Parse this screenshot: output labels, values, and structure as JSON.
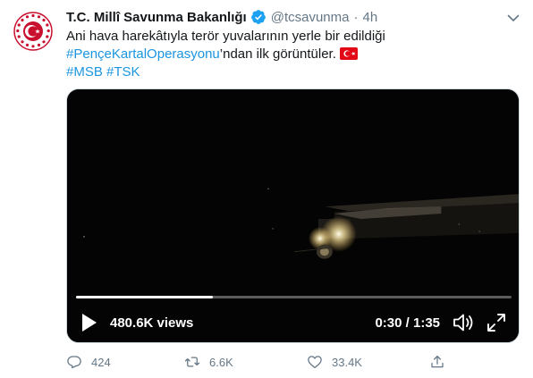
{
  "tweet": {
    "display_name": "T.C. Millî Savunma Bakanlığı",
    "handle": "@tcsavunma",
    "separator": "·",
    "time": "4h",
    "text_line1": "Ani hava harekâtıyla terör yuvalarının yerle bir edildiği",
    "hashtag_operation": "#PençeKartalOperasyonu",
    "text_line2_suffix": "’ndan ilk görüntüler.",
    "hashtag_msb": "#MSB",
    "hashtag_tsk": "#TSK"
  },
  "video": {
    "views": "480.6K views",
    "timecode": "0:30 / 1:35",
    "progress_fraction": 0.315
  },
  "actions": {
    "replies": "424",
    "retweets": "6.6K",
    "likes": "33.4K"
  },
  "colors": {
    "link": "#1b95e0",
    "verified": "#1da1f2",
    "avatar_red": "#c8102e",
    "flag_red": "#e30a17",
    "muted": "#657786"
  },
  "icons": {
    "avatar": "msb-emblem-logo",
    "verified": "verified-badge-icon",
    "caret": "chevron-down-icon",
    "flag": "turkey-flag-emoji",
    "play": "play-icon",
    "volume": "volume-icon",
    "fullscreen": "fullscreen-icon",
    "reply": "reply-icon",
    "retweet": "retweet-icon",
    "like": "heart-icon",
    "share": "share-icon"
  }
}
